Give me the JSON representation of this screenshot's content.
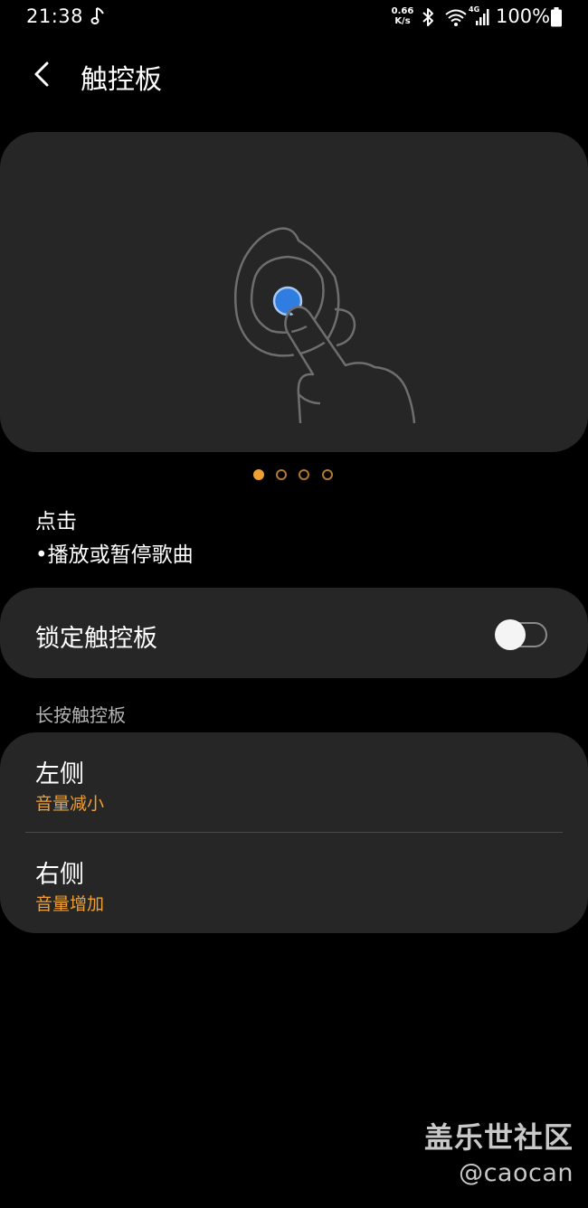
{
  "status_bar": {
    "time": "21:38",
    "net_speed_value": "0.66",
    "net_speed_unit": "K/s",
    "signal_label": "4G",
    "battery_percent": "100%",
    "icons": [
      "music-note-icon",
      "bluetooth-icon",
      "wifi-icon",
      "signal-icon",
      "battery-icon"
    ]
  },
  "header": {
    "back_icon": "chevron-left-icon",
    "title": "触控板"
  },
  "illustration": {
    "icon": "earbud-touch-illustration",
    "accent_color": "#2f7de1",
    "page_count": 4,
    "active_page": 1
  },
  "gesture": {
    "title": "点击",
    "description": "•播放或暂停歌曲"
  },
  "lock_touchpad": {
    "label": "锁定触控板",
    "enabled": false
  },
  "long_press": {
    "section_title": "长按触控板",
    "items": [
      {
        "title": "左侧",
        "value": "音量减小"
      },
      {
        "title": "右侧",
        "value": "音量增加"
      }
    ]
  },
  "colors": {
    "background": "#000000",
    "card": "#262626",
    "accent": "#f0a030",
    "secondary_text": "#b4b4b4"
  },
  "watermark": {
    "title": "盖乐世社区",
    "handle": "@caocan"
  }
}
